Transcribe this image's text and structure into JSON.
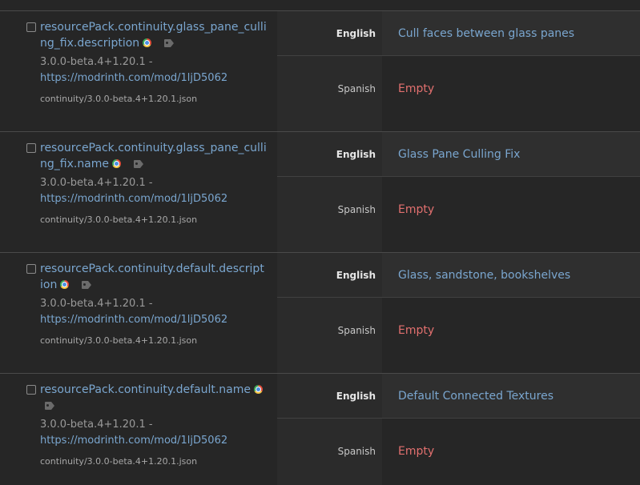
{
  "rows": [
    {
      "key": "resourcePack.continuity.glass_pane_culling_fix.description",
      "version": "3.0.0-beta.4+1.20.1 -",
      "url": "https://modrinth.com/mod/1ljD5062",
      "file": "continuity/3.0.0-beta.4+1.20.1.json",
      "lang_en": "English",
      "lang_es": "Spanish",
      "value_en": "Cull faces between glass panes",
      "value_es": "Empty"
    },
    {
      "key": "resourcePack.continuity.glass_pane_culling_fix.name",
      "version": "3.0.0-beta.4+1.20.1 -",
      "url": "https://modrinth.com/mod/1ljD5062",
      "file": "continuity/3.0.0-beta.4+1.20.1.json",
      "lang_en": "English",
      "lang_es": "Spanish",
      "value_en": "Glass Pane Culling Fix",
      "value_es": "Empty"
    },
    {
      "key": "resourcePack.continuity.default.description",
      "version": "3.0.0-beta.4+1.20.1 -",
      "url": "https://modrinth.com/mod/1ljD5062",
      "file": "continuity/3.0.0-beta.4+1.20.1.json",
      "lang_en": "English",
      "lang_es": "Spanish",
      "value_en": "Glass, sandstone, bookshelves",
      "value_es": "Empty"
    },
    {
      "key": "resourcePack.continuity.default.name",
      "version": "3.0.0-beta.4+1.20.1 -",
      "url": "https://modrinth.com/mod/1ljD5062",
      "file": "continuity/3.0.0-beta.4+1.20.1.json",
      "lang_en": "English",
      "lang_es": "Spanish",
      "value_en": "Default Connected Textures",
      "value_es": "Empty"
    }
  ],
  "icons": {
    "source": "chrome-icon",
    "tag": "tag-icon"
  },
  "colors": {
    "link": "#7aa6cf",
    "empty": "#e2706f",
    "background": "#262626"
  }
}
